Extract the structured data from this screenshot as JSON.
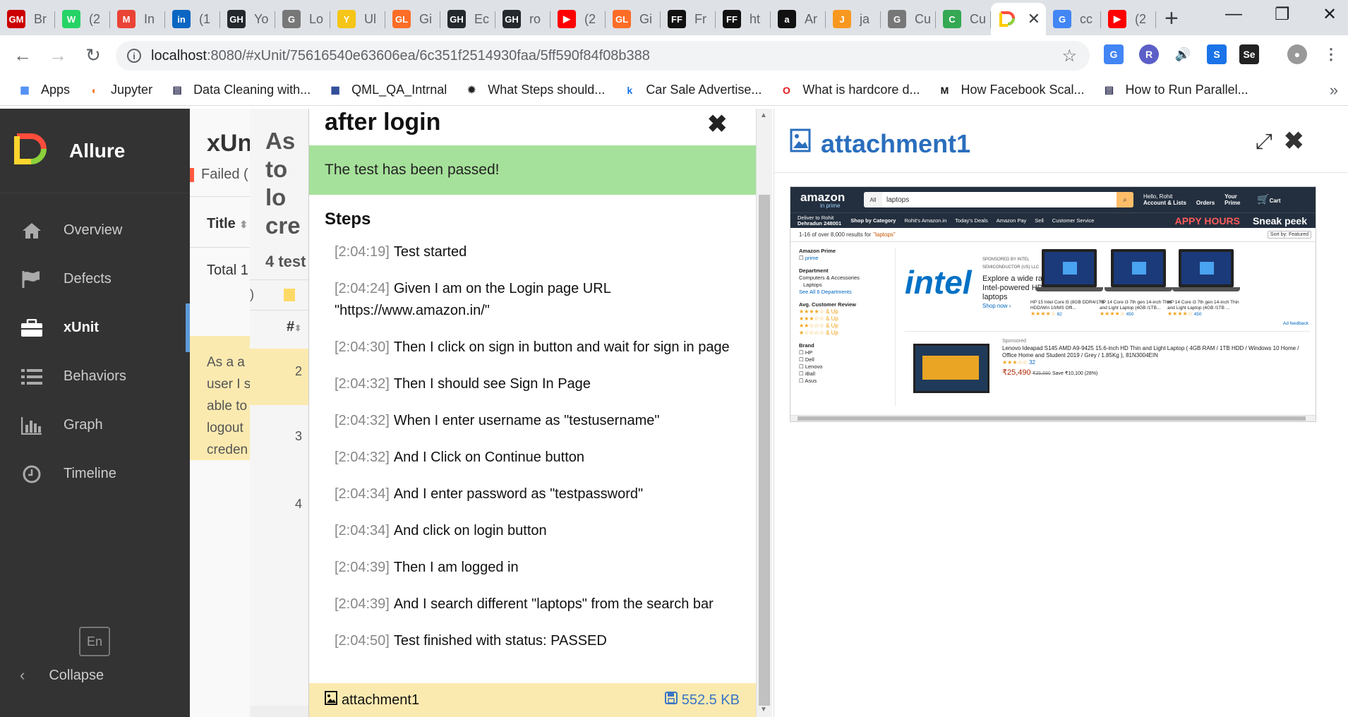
{
  "browser": {
    "tabs": [
      {
        "label": "Br",
        "icon": "GM",
        "color": "#c00"
      },
      {
        "label": "(2",
        "icon": "W",
        "color": "#25d366"
      },
      {
        "label": "In",
        "icon": "M",
        "color": "#ea4335"
      },
      {
        "label": "(1",
        "icon": "in",
        "color": "#0a66c2"
      },
      {
        "label": "Yo",
        "icon": "GH",
        "color": "#24292e"
      },
      {
        "label": "Lo",
        "icon": "G",
        "color": "#777"
      },
      {
        "label": "Ul",
        "icon": "Y",
        "color": "#f5c518"
      },
      {
        "label": "Gi",
        "icon": "GL",
        "color": "#fc6d26"
      },
      {
        "label": "Ec",
        "icon": "GH",
        "color": "#24292e"
      },
      {
        "label": "ro",
        "icon": "GH",
        "color": "#24292e"
      },
      {
        "label": "(2",
        "icon": "▶",
        "color": "#f00"
      },
      {
        "label": "Gi",
        "icon": "GL",
        "color": "#fc6d26"
      },
      {
        "label": "Fr",
        "icon": "FF",
        "color": "#111"
      },
      {
        "label": "ht",
        "icon": "FF",
        "color": "#111"
      },
      {
        "label": "Ar",
        "icon": "a",
        "color": "#111"
      },
      {
        "label": "ja",
        "icon": "J",
        "color": "#f89820"
      },
      {
        "label": "Cu",
        "icon": "G",
        "color": "#777"
      },
      {
        "label": "Cu",
        "icon": "C",
        "color": "#34a853"
      }
    ],
    "active_tab": {
      "label": "",
      "close": "✕"
    },
    "after_tabs": [
      {
        "label": "cc",
        "icon": "G",
        "color": "#4285f4"
      },
      {
        "label": "(2",
        "icon": "▶",
        "color": "#f00"
      }
    ],
    "new_tab": "+",
    "url_host": "localhost",
    "url_path": ":8080/#xUnit/75616540e63606ea/6c351f2514930faa/5ff590f84f08b388",
    "bookmarks": [
      {
        "label": "Apps",
        "icon": "apps-grid"
      },
      {
        "label": "Jupyter",
        "icon": "jupyter"
      },
      {
        "label": "Data Cleaning with...",
        "icon": "doc"
      },
      {
        "label": "QML_QA_Intrnal",
        "icon": "grid"
      },
      {
        "label": "What Steps should...",
        "icon": "bug"
      },
      {
        "label": "Car Sale Advertise...",
        "icon": "k"
      },
      {
        "label": "What is hardcore d...",
        "icon": "O"
      },
      {
        "label": "How Facebook Scal...",
        "icon": "M"
      },
      {
        "label": "How to Run Parallel...",
        "icon": "doc"
      }
    ],
    "bookmarks_overflow": "»"
  },
  "sidebar": {
    "brand": "Allure",
    "items": [
      {
        "label": "Overview",
        "icon": "home-icon"
      },
      {
        "label": "Defects",
        "icon": "flag-icon"
      },
      {
        "label": "xUnit",
        "icon": "briefcase-icon",
        "active": true
      },
      {
        "label": "Behaviors",
        "icon": "list-icon"
      },
      {
        "label": "Graph",
        "icon": "bar-chart-icon"
      },
      {
        "label": "Timeline",
        "icon": "clock-icon"
      }
    ],
    "language": "En",
    "collapse": "Collapse"
  },
  "background": {
    "title": "xUn",
    "failed": "Failed (",
    "col_title": "Title",
    "total": "Total 1",
    "desc": [
      "As a a",
      "user I s",
      "able to",
      "logout",
      "creden"
    ],
    "case_title": [
      "As",
      "to lo",
      "cre"
    ],
    "tests": "4 test",
    "hash_col": "#",
    "nums": [
      "2",
      "3",
      "4"
    ],
    "paren": ")"
  },
  "result": {
    "title": "after login",
    "close": "✖",
    "status_message": "The test has been passed!",
    "steps_title": "Steps",
    "steps": [
      {
        "time": "[2:04:19]",
        "text": "Test started"
      },
      {
        "time": "[2:04:24]",
        "text": "Given I am on the Login page URL \"https://www.amazon.in/\""
      },
      {
        "time": "[2:04:30]",
        "text": "Then I click on sign in button and wait for sign in page"
      },
      {
        "time": "[2:04:32]",
        "text": "Then I should see Sign In Page"
      },
      {
        "time": "[2:04:32]",
        "text": "When I enter username as \"testusername\""
      },
      {
        "time": "[2:04:32]",
        "text": "And I Click on Continue button"
      },
      {
        "time": "[2:04:34]",
        "text": "And I enter password as \"testpassword\""
      },
      {
        "time": "[2:04:34]",
        "text": "And click on login button"
      },
      {
        "time": "[2:04:39]",
        "text": "Then I am logged in"
      },
      {
        "time": "[2:04:39]",
        "text": "And I search different \"laptops\" from the search bar"
      },
      {
        "time": "[2:04:50]",
        "text": "Test finished with status: PASSED"
      }
    ],
    "attachment": {
      "name": "attachment1",
      "size": "552.5 KB"
    }
  },
  "attachment_pane": {
    "title": "attachment1",
    "amazon": {
      "logo": "amazon",
      "logo_sub": "in prime",
      "search_category": "All",
      "search_query": "laptops",
      "hello": "Hello, Rohit",
      "account": "Account & Lists",
      "orders": "Orders",
      "your_prime": "Your Prime",
      "cart": "Cart",
      "deliver_to": "Deliver to Rohit",
      "location": "Dehradun 248001",
      "shop_by": "Shop by Category",
      "nav": [
        "Rohit's Amazon.in",
        "Today's Deals",
        "Amazon Pay",
        "Sell",
        "Customer Service"
      ],
      "promo": "APPY HOURS",
      "promo2": "Sneak peek",
      "results": "1-16 of over 8,000 results for",
      "results_query": "\"laptops\"",
      "sort": "Sort by: Featured",
      "filters": {
        "prime_title": "Amazon Prime",
        "prime": "prime",
        "dept_title": "Department",
        "dept1": "Computers & Accessories",
        "dept2": "Laptops",
        "dept3": "See All 6 Departments",
        "review_title": "Avg. Customer Review",
        "review_rows": [
          "★★★★☆ & Up",
          "★★★☆☆ & Up",
          "★★☆☆☆ & Up",
          "★☆☆☆☆ & Up"
        ],
        "brand_title": "Brand",
        "brands": [
          "HP",
          "Dell",
          "Lenovo",
          "iBall",
          "Asus"
        ]
      },
      "intel": "intel",
      "sponsored_by": "SPONSORED BY INTEL SEMICONDUCTOR (US) LLC",
      "intel_copy": "Explore a wide range of Intel-powered HP laptops",
      "shop_now": "Shop now ›",
      "products": [
        {
          "title": "HP 15 Intel Core i5 (8GB DDR4/1TB HDD/Win 10/MS Offi...",
          "count": "82"
        },
        {
          "title": "HP 14 Core i3 7th gen 14-inch Thin and Light Laptop (4GB /1TB...",
          "count": "450"
        },
        {
          "title": "HP 14 Core i3 7th gen 14-inch Thin and Light Laptop (4GB /1TB ...",
          "count": "450"
        }
      ],
      "ad_feedback": "Ad feedback",
      "sponsored": "Sponsored",
      "lenovo_title": "Lenovo Ideapad S145 AMD A9-9425 15.6-inch HD Thin and Light Laptop ( 4GB RAM / 1TB HDD / Windows 10 Home / Office Home and Student 2019 / Grey / 1.85Kg ), 81N3004EIN",
      "lenovo_rating_count": "32",
      "lenovo_price": "₹25,490",
      "lenovo_mrp": "₹35,690",
      "lenovo_save": "Save ₹10,100 (28%)"
    }
  }
}
